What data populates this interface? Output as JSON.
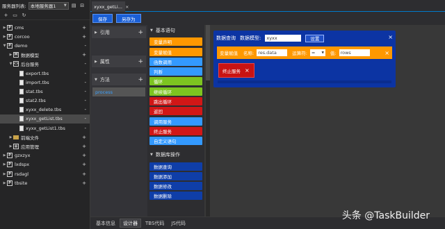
{
  "server_panel": {
    "label": "服务器列表:",
    "server_select": "本地服务器1",
    "tree": [
      {
        "label": "cms",
        "icon": "project-icon",
        "marker": "+",
        "expanded": false,
        "level": 0
      },
      {
        "label": "corcoo",
        "icon": "project-icon",
        "marker": "+",
        "expanded": false,
        "level": 0
      },
      {
        "label": "demo",
        "icon": "project-icon",
        "marker": "-",
        "expanded": true,
        "level": 0
      },
      {
        "label": "数据模型",
        "icon": "model-icon",
        "marker": "+",
        "expanded": false,
        "level": 1
      },
      {
        "label": "后台服务",
        "icon": "code-icon",
        "marker": "-",
        "expanded": true,
        "level": 1
      },
      {
        "label": "export.tbs",
        "icon": "file-icon",
        "marker": "-",
        "level": 2
      },
      {
        "label": "import.tbs",
        "icon": "file-icon",
        "marker": "-",
        "level": 2
      },
      {
        "label": "stat.tbs",
        "icon": "file-icon",
        "marker": "-",
        "level": 2
      },
      {
        "label": "stat2.tbs",
        "icon": "file-icon",
        "marker": "-",
        "level": 2
      },
      {
        "label": "xyxx_delete.tbs",
        "icon": "file-icon",
        "marker": "-",
        "level": 2
      },
      {
        "label": "xyxx_getList.tbs",
        "icon": "file-icon",
        "marker": "-",
        "level": 2,
        "selected": true
      },
      {
        "label": "xyxx_getList1.tbs",
        "icon": "file-icon",
        "marker": "-",
        "level": 2
      },
      {
        "label": "前端文件",
        "icon": "folder-icon",
        "marker": "+",
        "expanded": false,
        "level": 1
      },
      {
        "label": "应用管理",
        "icon": "app-icon",
        "marker": "+",
        "expanded": false,
        "level": 1
      },
      {
        "label": "gzxzyx",
        "icon": "project-icon",
        "marker": "+",
        "expanded": false,
        "level": 0
      },
      {
        "label": "lxdspx",
        "icon": "project-icon",
        "marker": "+",
        "expanded": false,
        "level": 0
      },
      {
        "label": "rsdagl",
        "icon": "project-icon",
        "marker": "+",
        "expanded": false,
        "level": 0
      },
      {
        "label": "tbsite",
        "icon": "project-icon",
        "marker": "+",
        "expanded": false,
        "level": 0
      }
    ]
  },
  "doc_tab": {
    "title": "xyxx_getLi...",
    "close": "×"
  },
  "actions": {
    "save": "保存",
    "save_as": "另存为"
  },
  "property_panel": {
    "references": "引用",
    "attributes": "属性",
    "methods": "方法",
    "method_item": "process",
    "plus": "+"
  },
  "palette": {
    "basic_header": "基本语句",
    "basic_items": [
      {
        "label": "变量声明",
        "color": "#ff9800"
      },
      {
        "label": "变量赋值",
        "color": "#ff9800"
      },
      {
        "label": "函数调用",
        "color": "#3399ff"
      },
      {
        "label": "判断",
        "color": "#3399ff"
      },
      {
        "label": "循环",
        "color": "#7dc420"
      },
      {
        "label": "继续循环",
        "color": "#7dc420"
      },
      {
        "label": "跳出循环",
        "color": "#d11717"
      },
      {
        "label": "返回",
        "color": "#d11717"
      },
      {
        "label": "调用服务",
        "color": "#3399ff"
      },
      {
        "label": "终止服务",
        "color": "#d11717"
      },
      {
        "label": "自定义语句",
        "color": "#3399ff"
      }
    ],
    "db_header": "数据库操作",
    "db_items": [
      {
        "label": "数据查询",
        "color": "#0f3ea8"
      },
      {
        "label": "数据添加",
        "color": "#0f3ea8"
      },
      {
        "label": "数据修改",
        "color": "#0f3ea8"
      },
      {
        "label": "数据删除",
        "color": "#0f3ea8"
      }
    ]
  },
  "canvas": {
    "query_block": {
      "title": "数据查询",
      "model_label": "数据模型:",
      "model_value": "xyxx",
      "settings_button": "设置",
      "close": "×"
    },
    "assign_row": {
      "type": "变量赋值",
      "name_label": "名称:",
      "name_value": "res.data",
      "operator_label": "运算符:",
      "operator_value": "=",
      "value_label": "值:",
      "value_value": "rows",
      "close": "×"
    },
    "end_row": {
      "label": "终止服务",
      "close": "×"
    }
  },
  "bottom_tabs": [
    {
      "label": "基本信息",
      "active": false
    },
    {
      "label": "设计器",
      "active": true
    },
    {
      "label": "TBS代码",
      "active": false
    },
    {
      "label": "JS代码",
      "active": false
    }
  ],
  "watermark": "头条 @TaskBuilder"
}
